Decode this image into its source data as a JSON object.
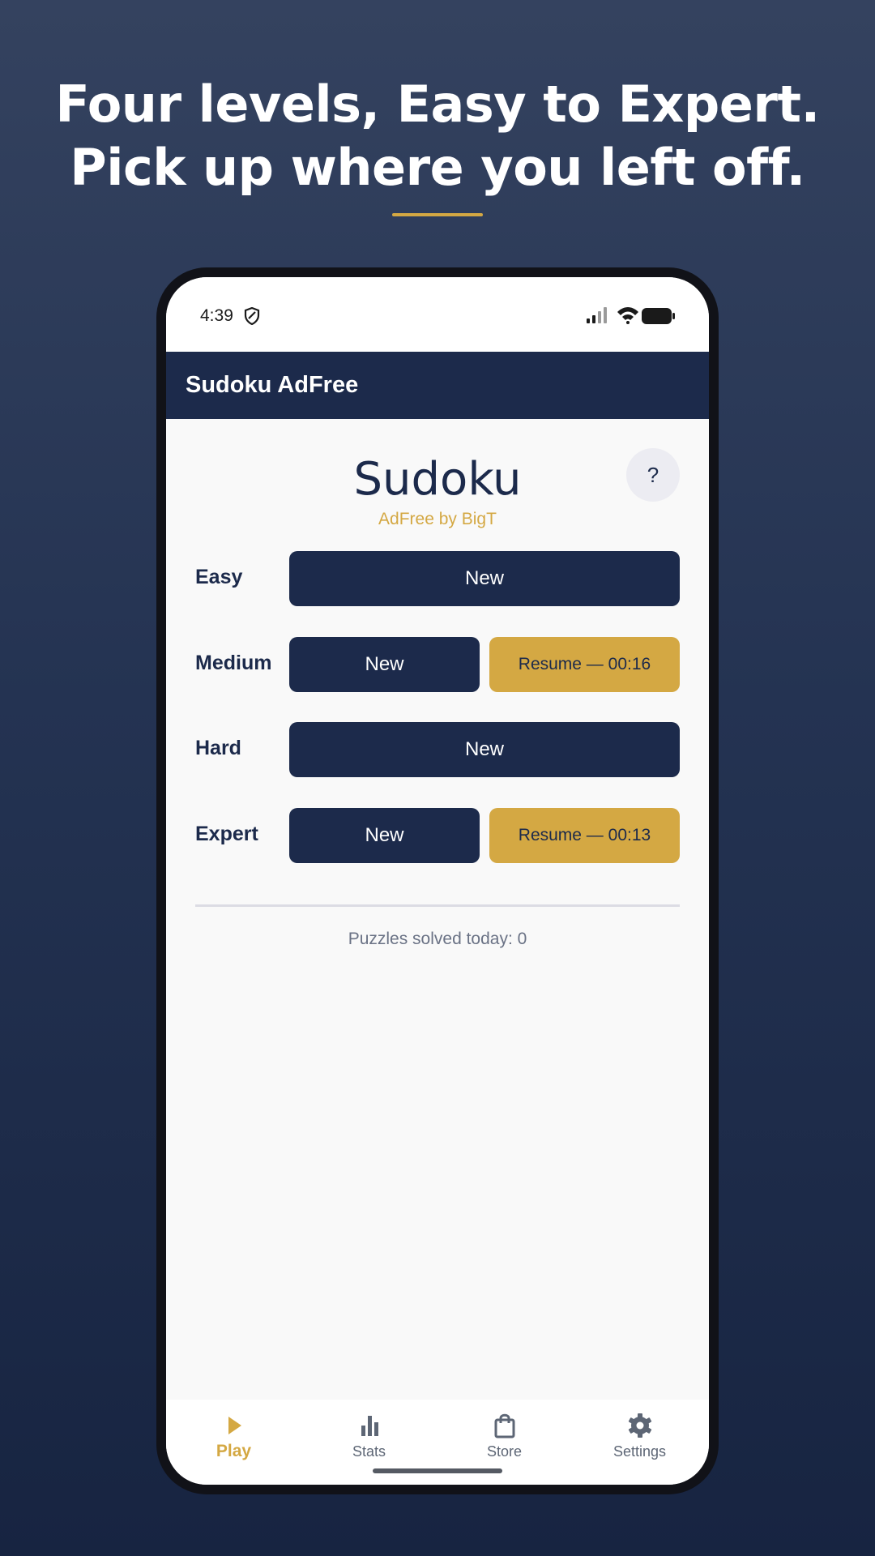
{
  "headline": {
    "line1": "Four levels, Easy to Expert.",
    "line2": "Pick up where you left off."
  },
  "status_bar": {
    "time": "4:39"
  },
  "app_bar": {
    "title": "Sudoku AdFree"
  },
  "home": {
    "title": "Sudoku",
    "subtitle": "AdFree by BigT",
    "help_label": "?",
    "levels": [
      {
        "label": "Easy",
        "new_label": "New"
      },
      {
        "label": "Medium",
        "new_label": "New",
        "resume_label": "Resume — 00:16"
      },
      {
        "label": "Hard",
        "new_label": "New"
      },
      {
        "label": "Expert",
        "new_label": "New",
        "resume_label": "Resume — 00:13"
      }
    ],
    "solved_today": "Puzzles solved today: 0"
  },
  "bottom_nav": {
    "items": [
      {
        "label": "Play",
        "icon": "play-icon",
        "active": true
      },
      {
        "label": "Stats",
        "icon": "bar-chart-icon",
        "active": false
      },
      {
        "label": "Store",
        "icon": "shopping-bag-icon",
        "active": false
      },
      {
        "label": "Settings",
        "icon": "gear-icon",
        "active": false
      }
    ]
  },
  "colors": {
    "navy": "#1c2a4b",
    "gold": "#d4a843",
    "background_top": "#34425f",
    "background_bottom": "#172441"
  }
}
